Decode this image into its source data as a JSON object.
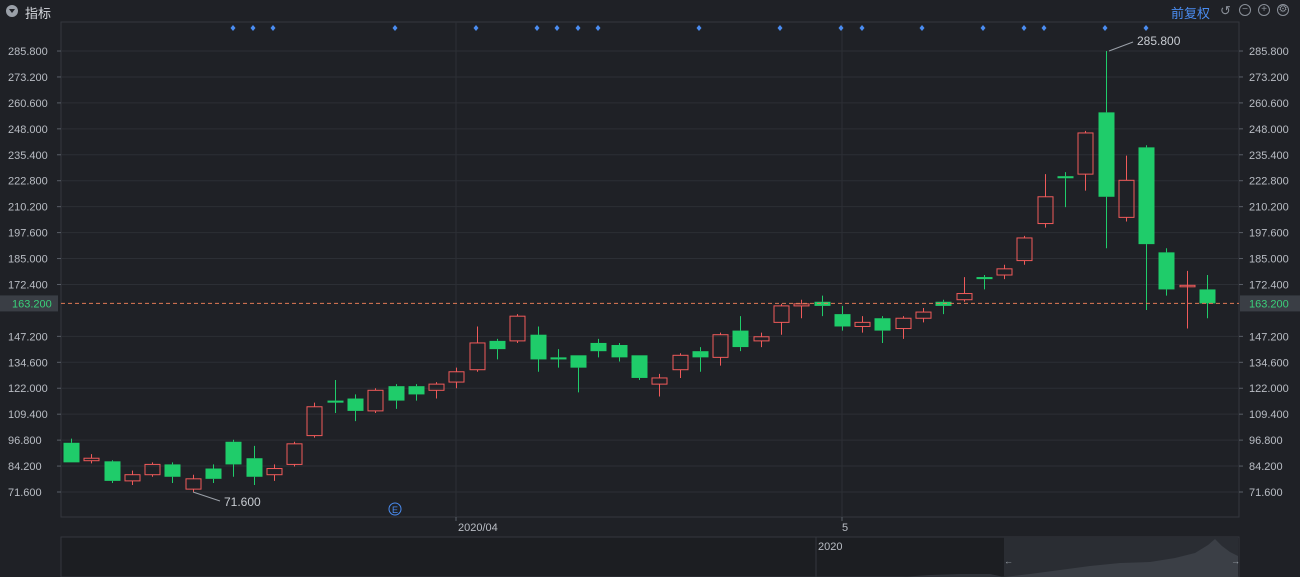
{
  "toolbar": {
    "title": "指标",
    "adjust_label": "前复权",
    "undo_icon": "undo-icon",
    "minus_icon": "zoom-out-icon",
    "plus_icon": "zoom-in-icon",
    "settings_icon": "gear-icon"
  },
  "colors": {
    "up": "#f05a5a",
    "down": "#1fcc6a",
    "grid": "#2c2f35",
    "marker": "#4a8cf0",
    "price_line": "#e07a55"
  },
  "chart_data": {
    "type": "candlestick",
    "y_ticks": [
      "285.800",
      "273.200",
      "260.600",
      "248.000",
      "235.400",
      "222.800",
      "210.200",
      "197.600",
      "185.000",
      "172.400",
      "163.200",
      "147.200",
      "134.600",
      "122.000",
      "109.400",
      "96.800",
      "84.200",
      "71.600"
    ],
    "x_labels": [
      "2020/04",
      "5"
    ],
    "ylim": [
      71.6,
      285.8
    ],
    "current_price": "163.200",
    "max_label": "285.800",
    "min_label": "71.600",
    "event_marker": "E",
    "overview_label": "2020",
    "candles": [
      {
        "o": 95.5,
        "c": 86,
        "h": 97.5,
        "l": 86
      },
      {
        "o": 86.8,
        "c": 88,
        "h": 90,
        "l": 85.5
      },
      {
        "o": 86.5,
        "c": 77,
        "h": 87,
        "l": 76
      },
      {
        "o": 77,
        "c": 80,
        "h": 82,
        "l": 75
      },
      {
        "o": 80,
        "c": 85,
        "h": 86,
        "l": 79
      },
      {
        "o": 85,
        "c": 79,
        "h": 86,
        "l": 76
      },
      {
        "o": 73,
        "c": 78,
        "h": 80,
        "l": 71.6
      },
      {
        "o": 83,
        "c": 78,
        "h": 85,
        "l": 76
      },
      {
        "o": 96,
        "c": 85,
        "h": 97,
        "l": 79
      },
      {
        "o": 88,
        "c": 79,
        "h": 94,
        "l": 75
      },
      {
        "o": 80,
        "c": 83,
        "h": 85,
        "l": 77
      },
      {
        "o": 85,
        "c": 95,
        "h": 96,
        "l": 84
      },
      {
        "o": 99,
        "c": 113,
        "h": 115,
        "l": 98
      },
      {
        "o": 116,
        "c": 115,
        "h": 126,
        "l": 110
      },
      {
        "o": 117,
        "c": 111,
        "h": 119,
        "l": 106
      },
      {
        "o": 111,
        "c": 121,
        "h": 122,
        "l": 110
      },
      {
        "o": 123,
        "c": 116,
        "h": 124,
        "l": 112
      },
      {
        "o": 123,
        "c": 119,
        "h": 124,
        "l": 116
      },
      {
        "o": 121,
        "c": 124,
        "h": 125,
        "l": 117
      },
      {
        "o": 125,
        "c": 130,
        "h": 132,
        "l": 122
      },
      {
        "o": 131,
        "c": 144,
        "h": 152,
        "l": 130
      },
      {
        "o": 145,
        "c": 141,
        "h": 146,
        "l": 136
      },
      {
        "o": 145,
        "c": 157,
        "h": 158,
        "l": 144
      },
      {
        "o": 148,
        "c": 136,
        "h": 152,
        "l": 130
      },
      {
        "o": 137,
        "c": 136,
        "h": 141,
        "l": 132
      },
      {
        "o": 138,
        "c": 132,
        "h": 138,
        "l": 120
      },
      {
        "o": 144,
        "c": 140,
        "h": 146,
        "l": 137
      },
      {
        "o": 143,
        "c": 137,
        "h": 144,
        "l": 135
      },
      {
        "o": 138,
        "c": 127,
        "h": 138,
        "l": 126
      },
      {
        "o": 124,
        "c": 127,
        "h": 129,
        "l": 118
      },
      {
        "o": 131,
        "c": 138,
        "h": 139,
        "l": 127
      },
      {
        "o": 140,
        "c": 137,
        "h": 142,
        "l": 130
      },
      {
        "o": 137,
        "c": 148,
        "h": 149,
        "l": 133
      },
      {
        "o": 150,
        "c": 142,
        "h": 157,
        "l": 140
      },
      {
        "o": 145,
        "c": 147,
        "h": 149,
        "l": 142
      },
      {
        "o": 154,
        "c": 162,
        "h": 163,
        "l": 148
      },
      {
        "o": 162,
        "c": 163,
        "h": 165,
        "l": 156
      },
      {
        "o": 164,
        "c": 162,
        "h": 167,
        "l": 157
      },
      {
        "o": 158,
        "c": 152,
        "h": 162,
        "l": 150
      },
      {
        "o": 152,
        "c": 154,
        "h": 157,
        "l": 149
      },
      {
        "o": 156,
        "c": 150,
        "h": 157,
        "l": 144
      },
      {
        "o": 151,
        "c": 156,
        "h": 157,
        "l": 146
      },
      {
        "o": 156,
        "c": 159,
        "h": 161,
        "l": 154
      },
      {
        "o": 164,
        "c": 162,
        "h": 165,
        "l": 158
      },
      {
        "o": 165,
        "c": 168,
        "h": 176,
        "l": 164
      },
      {
        "o": 176,
        "c": 175,
        "h": 177,
        "l": 170
      },
      {
        "o": 177,
        "c": 180,
        "h": 182,
        "l": 175
      },
      {
        "o": 184,
        "c": 195,
        "h": 196,
        "l": 182
      },
      {
        "o": 202,
        "c": 215,
        "h": 226,
        "l": 200
      },
      {
        "o": 225,
        "c": 224,
        "h": 227,
        "l": 210
      },
      {
        "o": 226,
        "c": 246,
        "h": 247,
        "l": 218
      },
      {
        "o": 256,
        "c": 215,
        "h": 285.8,
        "l": 190
      },
      {
        "o": 205,
        "c": 223,
        "h": 235,
        "l": 203
      },
      {
        "o": 239,
        "c": 192,
        "h": 240,
        "l": 160
      },
      {
        "o": 188,
        "c": 170,
        "h": 190,
        "l": 167
      },
      {
        "o": 172,
        "c": 172,
        "h": 179,
        "l": 151
      },
      {
        "o": 170,
        "c": 163.2,
        "h": 177,
        "l": 156
      }
    ]
  }
}
